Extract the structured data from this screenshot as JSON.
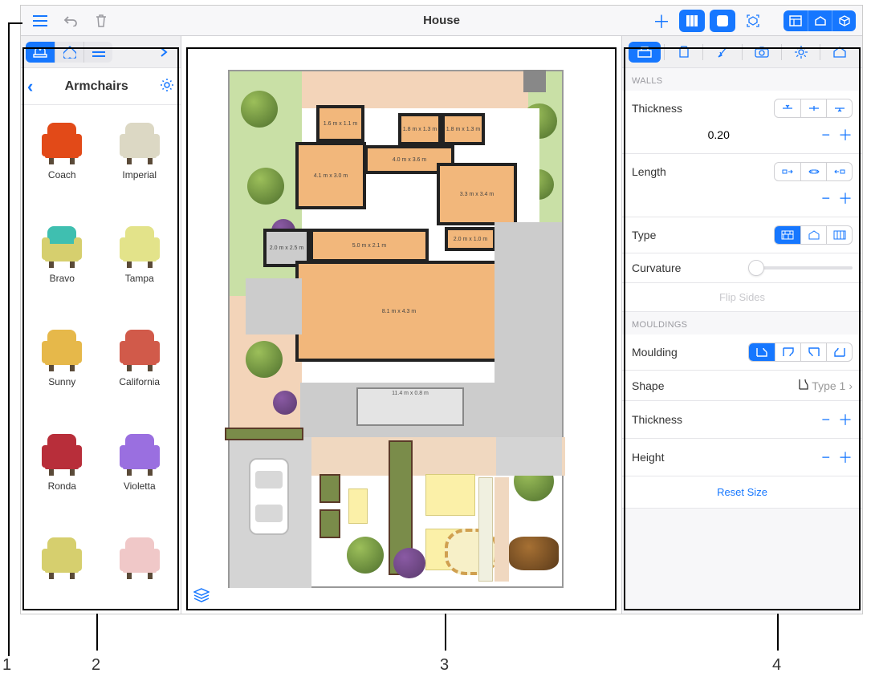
{
  "toolbar": {
    "title": "House"
  },
  "library": {
    "category": "Armchairs",
    "items": [
      {
        "name": "Coach",
        "color": "#e24a18",
        "back": "#e24a18"
      },
      {
        "name": "Imperial",
        "color": "#dcd8c4",
        "back": "#dcd8c4"
      },
      {
        "name": "Bravo",
        "color": "#d6cf6e",
        "back": "#3fbfb0"
      },
      {
        "name": "Tampa",
        "color": "#e3e38a",
        "back": "#e3e38a"
      },
      {
        "name": "Sunny",
        "color": "#e6b84a",
        "back": "#e6b84a"
      },
      {
        "name": "California",
        "color": "#d15a4a",
        "back": "#d15a4a"
      },
      {
        "name": "Ronda",
        "color": "#b82e3a",
        "back": "#b82e3a"
      },
      {
        "name": "Violetta",
        "color": "#9a6fe0",
        "back": "#9a6fe0"
      },
      {
        "name": "",
        "color": "#d6cf6e",
        "back": "#d6cf6e"
      },
      {
        "name": "",
        "color": "#f0c8c8",
        "back": "#f0c8c8"
      }
    ]
  },
  "rooms": [
    {
      "label": "1.6 m x 1.1 m"
    },
    {
      "label": "1.8 m x 1.3 m"
    },
    {
      "label": "1.8 m x 1.3 m"
    },
    {
      "label": "4.0 m x 3.6 m"
    },
    {
      "label": "4.1 m x 3.0 m"
    },
    {
      "label": "3.3 m x 3.4 m"
    },
    {
      "label": "2.0 m x 2.5 m"
    },
    {
      "label": "5.0 m x 2.1 m"
    },
    {
      "label": "2.0 m x 1.0 m"
    },
    {
      "label": "8.1 m x 4.3 m"
    },
    {
      "label": "11.4 m x 0.8 m"
    }
  ],
  "inspector": {
    "walls_label": "WALLS",
    "thickness_label": "Thickness",
    "thickness_value": "0.20",
    "length_label": "Length",
    "type_label": "Type",
    "curvature_label": "Curvature",
    "flip_label": "Flip Sides",
    "mouldings_label": "MOULDINGS",
    "moulding_label": "Moulding",
    "shape_label": "Shape",
    "shape_value": "Type 1",
    "m_thickness_label": "Thickness",
    "height_label": "Height",
    "reset_label": "Reset Size"
  },
  "callouts": {
    "n1": "1",
    "n2": "2",
    "n3": "3",
    "n4": "4"
  }
}
